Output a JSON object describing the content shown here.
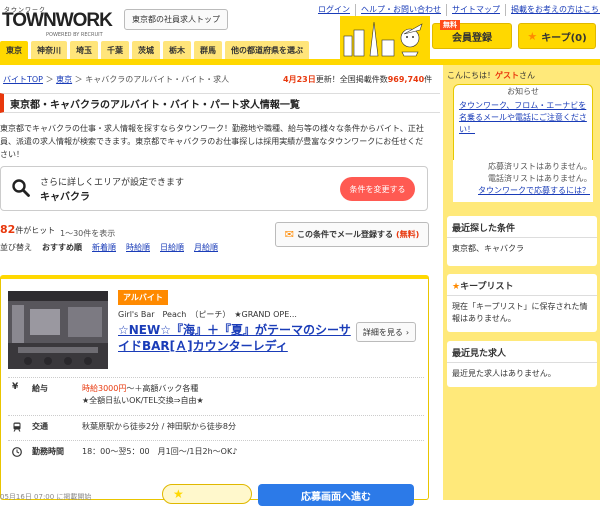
{
  "header": {
    "logo_kana": "タウンワーク",
    "logo_text": "TOWNWORK",
    "logo_sub": "POWERED BY RECRUIT",
    "corp_button": "東京都の社員求人トップ",
    "top_links": [
      "ログイン",
      "ヘルプ・お問い合わせ",
      "サイトマップ",
      "掲載をお考えの方はこちら"
    ],
    "login_badge": "無料",
    "login_button": "会員登録",
    "keep_button": "キープ(0)"
  },
  "tabs": [
    "東京",
    "神奈川",
    "埼玉",
    "千葉",
    "茨城",
    "栃木",
    "群馬",
    "他の都道府県を選ぶ"
  ],
  "breadcrumb": [
    "バイトTOP",
    "東京",
    "キャバクラのアルバイト・バイト・求人"
  ],
  "update": {
    "date": "4月23日",
    "text": "更新！全国掲載件数",
    "count": "969,740",
    "unit": "件"
  },
  "headline": "東京都・キャバクラのアルバイト・バイト・パート求人情報一覧",
  "description": "東京都でキャバクラの仕事・求人情報を探すならタウンワーク！勤務地や職種、給与等の様々な条件からバイト、正社員、派遣の求人情報が検索できます。東京都でキャバクラのお仕事探しは採用実績が豊富なタウンワークにお任せください！",
  "search": {
    "hint": "さらに詳しくエリアが設定できます",
    "condition": "キャバクラ",
    "change_button": "条件を変更する"
  },
  "results": {
    "count": "82",
    "count_label": "件がヒット",
    "range": "1〜30件を表示",
    "mail_button": "この条件でメール登録する",
    "mail_free": "(無料)",
    "sort_label": "並び替え",
    "sort_options": [
      "おすすめ順",
      "新着順",
      "時給順",
      "日給順",
      "月給順"
    ]
  },
  "job": {
    "type": "アルバイト",
    "shop": "Girl's Bar　Peach　（ピーチ）　★GRAND OPE...",
    "title": "☆NEW☆『海』＋『夏』がテーマのシーサイドBAR[Ａ]カウンターレディ",
    "detail_button": "詳細を見る",
    "rows": [
      {
        "key": "給与",
        "value_red": "時給3000円",
        "value": "〜＋高額バック各種",
        "value2": "★全額日払いOK/TEL交換⇒自由★"
      },
      {
        "key": "交通",
        "value": "秋葉原駅から徒歩2分 / 神田駅から徒歩8分"
      },
      {
        "key": "勤務時間",
        "value": "18：00〜翌5：00　月1回〜/1日2h〜OK♪"
      }
    ],
    "posted": "05月16日 07:00 に掲載開始",
    "apply_button": "応募画面へ進む"
  },
  "sidebar": {
    "greeting_prefix": "こんにちは！",
    "greeting_name": "ゲスト",
    "greeting_suffix": "さん",
    "notice_title": "お知らせ",
    "notice_body": "タウンワーク、フロム・エーナビを名乗るメールや電話にご注意ください！",
    "keep_line1": "応募済リストはありません。",
    "keep_line2": "電話済リストはありません。",
    "keep_link": "タウンワークで応募するには？",
    "recent_title": "最近探した条件",
    "recent_value": "東京都、キャバクラ",
    "keeplist_title": "キープリスト",
    "keeplist_value": "現在「キープリスト」に保存された情報はありません。",
    "viewed_title": "最近見た求人",
    "viewed_value": "最近見た求人はありません。"
  },
  "colors": {
    "brand_yellow": "#ffd800",
    "accent_red": "#e8380d",
    "link_blue": "#1a3cb8",
    "apply_blue": "#2c7ae8"
  }
}
